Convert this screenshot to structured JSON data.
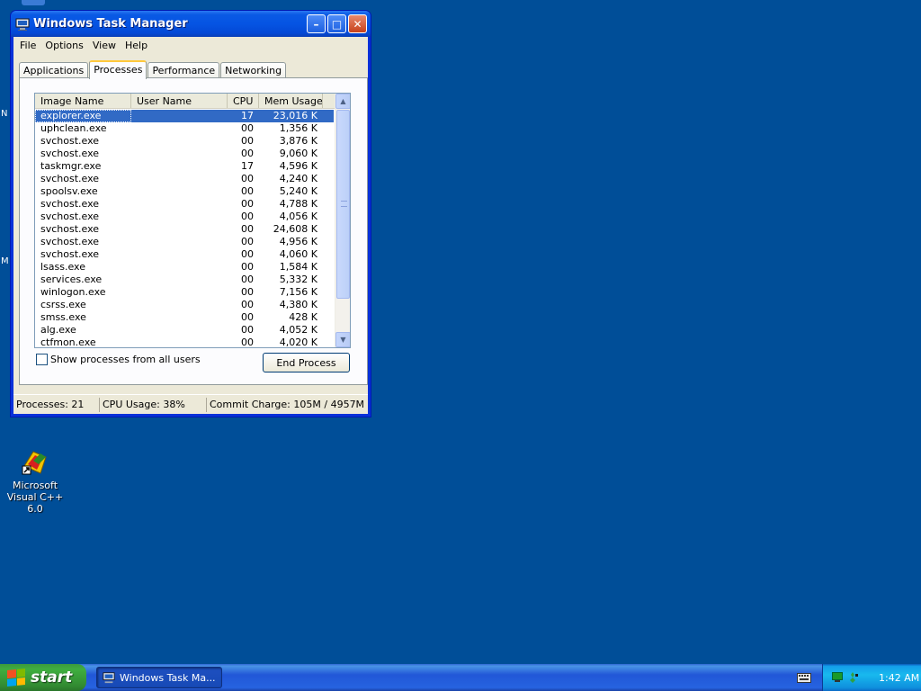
{
  "window": {
    "title": "Windows Task Manager",
    "controls": {
      "minimize": "–",
      "maximize": "□",
      "close": "✕"
    }
  },
  "menu": [
    "File",
    "Options",
    "View",
    "Help"
  ],
  "tabs": [
    {
      "label": "Applications",
      "active": false
    },
    {
      "label": "Processes",
      "active": true
    },
    {
      "label": "Performance",
      "active": false
    },
    {
      "label": "Networking",
      "active": false
    }
  ],
  "processes": {
    "columns": [
      "Image Name",
      "User Name",
      "CPU",
      "Mem Usage"
    ],
    "rows": [
      {
        "name": "explorer.exe",
        "user": "",
        "cpu": "17",
        "mem": "23,016 K",
        "selected": true
      },
      {
        "name": "uphclean.exe",
        "user": "",
        "cpu": "00",
        "mem": "1,356 K"
      },
      {
        "name": "svchost.exe",
        "user": "",
        "cpu": "00",
        "mem": "3,876 K"
      },
      {
        "name": "svchost.exe",
        "user": "",
        "cpu": "00",
        "mem": "9,060 K"
      },
      {
        "name": "taskmgr.exe",
        "user": "",
        "cpu": "17",
        "mem": "4,596 K"
      },
      {
        "name": "svchost.exe",
        "user": "",
        "cpu": "00",
        "mem": "4,240 K"
      },
      {
        "name": "spoolsv.exe",
        "user": "",
        "cpu": "00",
        "mem": "5,240 K"
      },
      {
        "name": "svchost.exe",
        "user": "",
        "cpu": "00",
        "mem": "4,788 K"
      },
      {
        "name": "svchost.exe",
        "user": "",
        "cpu": "00",
        "mem": "4,056 K"
      },
      {
        "name": "svchost.exe",
        "user": "",
        "cpu": "00",
        "mem": "24,608 K"
      },
      {
        "name": "svchost.exe",
        "user": "",
        "cpu": "00",
        "mem": "4,956 K"
      },
      {
        "name": "svchost.exe",
        "user": "",
        "cpu": "00",
        "mem": "4,060 K"
      },
      {
        "name": "lsass.exe",
        "user": "",
        "cpu": "00",
        "mem": "1,584 K"
      },
      {
        "name": "services.exe",
        "user": "",
        "cpu": "00",
        "mem": "5,332 K"
      },
      {
        "name": "winlogon.exe",
        "user": "",
        "cpu": "00",
        "mem": "7,156 K"
      },
      {
        "name": "csrss.exe",
        "user": "",
        "cpu": "00",
        "mem": "4,380 K"
      },
      {
        "name": "smss.exe",
        "user": "",
        "cpu": "00",
        "mem": "428 K"
      },
      {
        "name": "alg.exe",
        "user": "",
        "cpu": "00",
        "mem": "4,052 K"
      },
      {
        "name": "ctfmon.exe",
        "user": "",
        "cpu": "00",
        "mem": "4,020 K"
      }
    ]
  },
  "show_all_users": {
    "label": "Show processes from all users",
    "checked": false
  },
  "end_process_label": "End Process",
  "status": {
    "processes": "Processes: 21",
    "cpu_usage": "CPU Usage: 38%",
    "commit_charge": "Commit Charge: 105M / 4957M"
  },
  "desktop": {
    "edge_glyph_1": "N",
    "edge_glyph_2": "M",
    "icon_label": "Microsoft Visual C++ 6.0"
  },
  "taskbar": {
    "start_label": "start",
    "task_button_label": "Windows Task Ma...",
    "clock": "1:42 AM"
  },
  "colors": {
    "desktop": "#004e98",
    "title_bar": "#0554e3",
    "selection": "#316ac5",
    "start_button": "#3fae3f"
  }
}
